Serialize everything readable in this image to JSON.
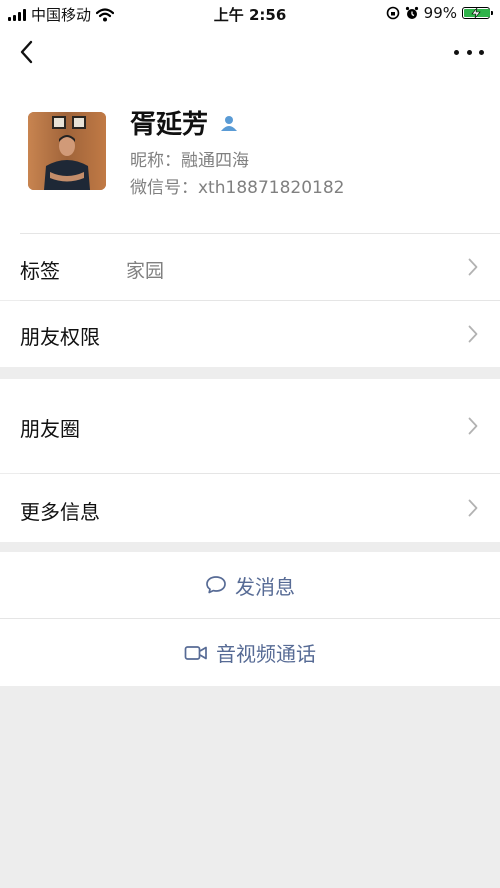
{
  "status_bar": {
    "carrier": "中国移动",
    "time": "上午 2:56",
    "battery": "99%",
    "battery_level": 0.99,
    "icons": [
      "signal-icon",
      "wifi-icon",
      "rotation-lock-icon",
      "alarm-icon",
      "battery-charging-icon"
    ]
  },
  "nav": {
    "back_icon": "chevron-left-icon",
    "more_icon": "more-dots-icon"
  },
  "profile": {
    "name": "胥延芳",
    "nickname": "昵称：融通四海",
    "wechat_id": "微信号：xth18871820182",
    "contact_icon": "person-icon"
  },
  "rows": {
    "tags_label": "标签",
    "tags_value": "家园",
    "permissions_label": "朋友权限",
    "moments_label": "朋友圈",
    "more_info_label": "更多信息"
  },
  "actions": {
    "send_message": "发消息",
    "av_call": "音视频通话"
  },
  "colors": {
    "link_blue": "#576b95",
    "background": "#ededed",
    "battery_green": "#2fb34a"
  }
}
